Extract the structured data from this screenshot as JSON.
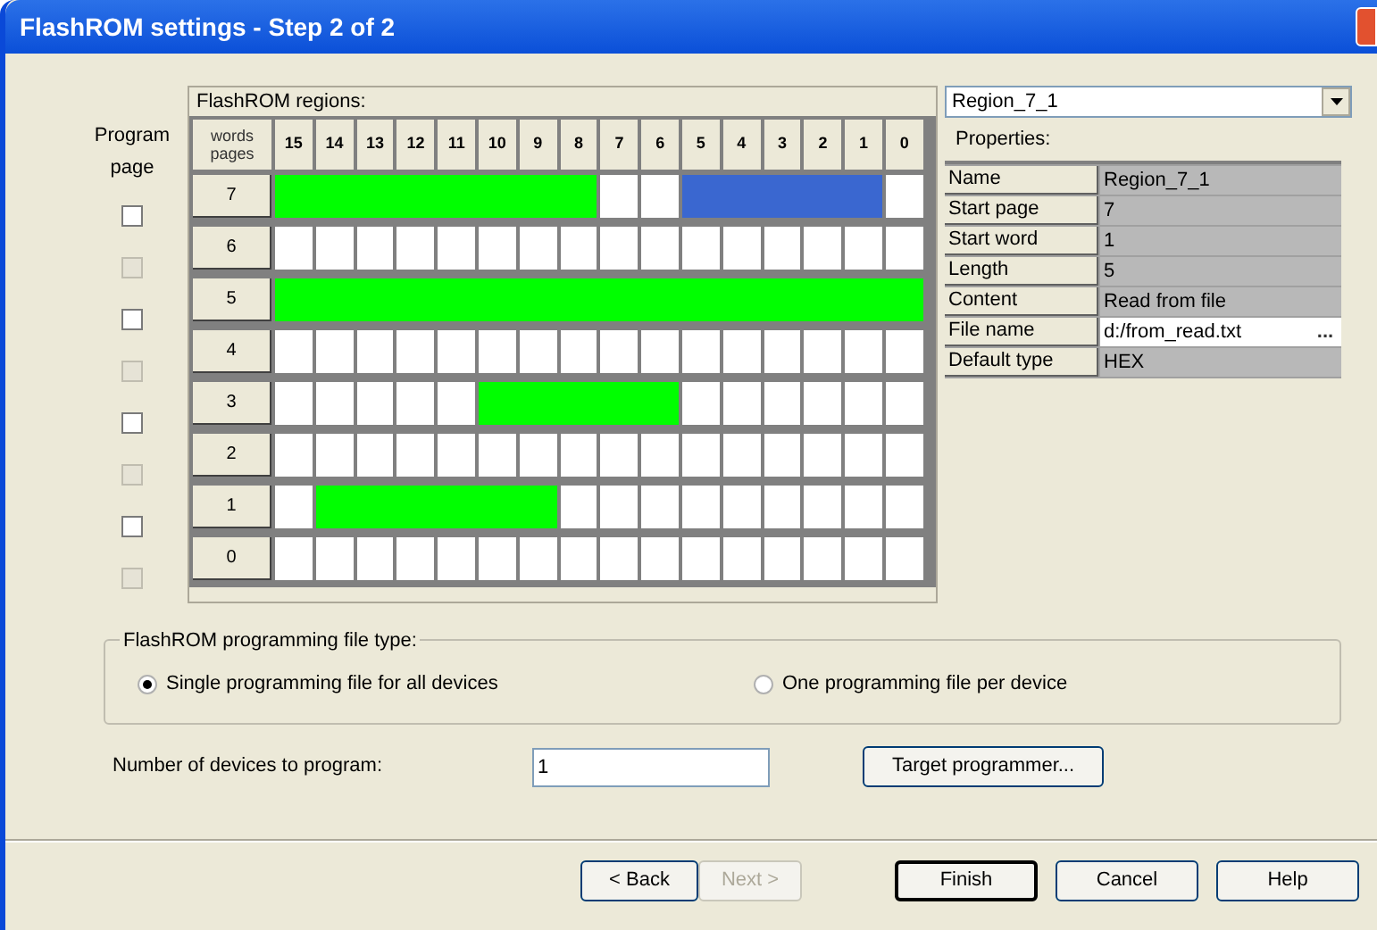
{
  "window": {
    "title": "FlashROM settings - Step 2 of 2"
  },
  "program_page_label": [
    "Program",
    "page"
  ],
  "regions_panel": {
    "title": "FlashROM regions:",
    "corner_label": [
      "words",
      "pages"
    ],
    "words": [
      "15",
      "14",
      "13",
      "12",
      "11",
      "10",
      "9",
      "8",
      "7",
      "6",
      "5",
      "4",
      "3",
      "2",
      "1",
      "0"
    ],
    "rows": [
      {
        "page": "7",
        "program": false,
        "disabled": false,
        "cells": [
          {
            "filled": true,
            "selected": false
          },
          {
            "filled": true,
            "selected": false
          },
          {
            "filled": true,
            "selected": false
          },
          {
            "filled": true,
            "selected": false
          },
          {
            "filled": true,
            "selected": false
          },
          {
            "filled": true,
            "selected": false
          },
          {
            "filled": true,
            "selected": false
          },
          {
            "filled": true,
            "selected": false
          },
          {
            "filled": false,
            "selected": false
          },
          {
            "filled": false,
            "selected": false
          },
          {
            "filled": true,
            "selected": true
          },
          {
            "filled": true,
            "selected": true
          },
          {
            "filled": true,
            "selected": true
          },
          {
            "filled": true,
            "selected": true
          },
          {
            "filled": true,
            "selected": true
          },
          {
            "filled": false,
            "selected": false
          }
        ]
      },
      {
        "page": "6",
        "program": false,
        "disabled": true,
        "cells": [
          {
            "filled": false,
            "selected": false
          },
          {
            "filled": false,
            "selected": false
          },
          {
            "filled": false,
            "selected": false
          },
          {
            "filled": false,
            "selected": false
          },
          {
            "filled": false,
            "selected": false
          },
          {
            "filled": false,
            "selected": false
          },
          {
            "filled": false,
            "selected": false
          },
          {
            "filled": false,
            "selected": false
          },
          {
            "filled": false,
            "selected": false
          },
          {
            "filled": false,
            "selected": false
          },
          {
            "filled": false,
            "selected": false
          },
          {
            "filled": false,
            "selected": false
          },
          {
            "filled": false,
            "selected": false
          },
          {
            "filled": false,
            "selected": false
          },
          {
            "filled": false,
            "selected": false
          },
          {
            "filled": false,
            "selected": false
          }
        ]
      },
      {
        "page": "5",
        "program": false,
        "disabled": false,
        "cells": [
          {
            "filled": true,
            "selected": false
          },
          {
            "filled": true,
            "selected": false
          },
          {
            "filled": true,
            "selected": false
          },
          {
            "filled": true,
            "selected": false
          },
          {
            "filled": true,
            "selected": false
          },
          {
            "filled": true,
            "selected": false
          },
          {
            "filled": true,
            "selected": false
          },
          {
            "filled": true,
            "selected": false
          },
          {
            "filled": true,
            "selected": false
          },
          {
            "filled": true,
            "selected": false
          },
          {
            "filled": true,
            "selected": false
          },
          {
            "filled": true,
            "selected": false
          },
          {
            "filled": true,
            "selected": false
          },
          {
            "filled": true,
            "selected": false
          },
          {
            "filled": true,
            "selected": false
          },
          {
            "filled": true,
            "selected": false
          }
        ]
      },
      {
        "page": "4",
        "program": false,
        "disabled": true,
        "cells": [
          {
            "filled": false,
            "selected": false
          },
          {
            "filled": false,
            "selected": false
          },
          {
            "filled": false,
            "selected": false
          },
          {
            "filled": false,
            "selected": false
          },
          {
            "filled": false,
            "selected": false
          },
          {
            "filled": false,
            "selected": false
          },
          {
            "filled": false,
            "selected": false
          },
          {
            "filled": false,
            "selected": false
          },
          {
            "filled": false,
            "selected": false
          },
          {
            "filled": false,
            "selected": false
          },
          {
            "filled": false,
            "selected": false
          },
          {
            "filled": false,
            "selected": false
          },
          {
            "filled": false,
            "selected": false
          },
          {
            "filled": false,
            "selected": false
          },
          {
            "filled": false,
            "selected": false
          },
          {
            "filled": false,
            "selected": false
          }
        ]
      },
      {
        "page": "3",
        "program": false,
        "disabled": false,
        "cells": [
          {
            "filled": false,
            "selected": false
          },
          {
            "filled": false,
            "selected": false
          },
          {
            "filled": false,
            "selected": false
          },
          {
            "filled": false,
            "selected": false
          },
          {
            "filled": false,
            "selected": false
          },
          {
            "filled": true,
            "selected": false
          },
          {
            "filled": true,
            "selected": false
          },
          {
            "filled": true,
            "selected": false
          },
          {
            "filled": true,
            "selected": false
          },
          {
            "filled": true,
            "selected": false
          },
          {
            "filled": false,
            "selected": false
          },
          {
            "filled": false,
            "selected": false
          },
          {
            "filled": false,
            "selected": false
          },
          {
            "filled": false,
            "selected": false
          },
          {
            "filled": false,
            "selected": false
          },
          {
            "filled": false,
            "selected": false
          }
        ]
      },
      {
        "page": "2",
        "program": false,
        "disabled": true,
        "cells": [
          {
            "filled": false,
            "selected": false
          },
          {
            "filled": false,
            "selected": false
          },
          {
            "filled": false,
            "selected": false
          },
          {
            "filled": false,
            "selected": false
          },
          {
            "filled": false,
            "selected": false
          },
          {
            "filled": false,
            "selected": false
          },
          {
            "filled": false,
            "selected": false
          },
          {
            "filled": false,
            "selected": false
          },
          {
            "filled": false,
            "selected": false
          },
          {
            "filled": false,
            "selected": false
          },
          {
            "filled": false,
            "selected": false
          },
          {
            "filled": false,
            "selected": false
          },
          {
            "filled": false,
            "selected": false
          },
          {
            "filled": false,
            "selected": false
          },
          {
            "filled": false,
            "selected": false
          },
          {
            "filled": false,
            "selected": false
          }
        ]
      },
      {
        "page": "1",
        "program": false,
        "disabled": false,
        "cells": [
          {
            "filled": false,
            "selected": false
          },
          {
            "filled": true,
            "selected": false
          },
          {
            "filled": true,
            "selected": false
          },
          {
            "filled": true,
            "selected": false
          },
          {
            "filled": true,
            "selected": false
          },
          {
            "filled": true,
            "selected": false
          },
          {
            "filled": true,
            "selected": false
          },
          {
            "filled": false,
            "selected": false
          },
          {
            "filled": false,
            "selected": false
          },
          {
            "filled": false,
            "selected": false
          },
          {
            "filled": false,
            "selected": false
          },
          {
            "filled": false,
            "selected": false
          },
          {
            "filled": false,
            "selected": false
          },
          {
            "filled": false,
            "selected": false
          },
          {
            "filled": false,
            "selected": false
          },
          {
            "filled": false,
            "selected": false
          }
        ]
      },
      {
        "page": "0",
        "program": false,
        "disabled": true,
        "cells": [
          {
            "filled": false,
            "selected": false
          },
          {
            "filled": false,
            "selected": false
          },
          {
            "filled": false,
            "selected": false
          },
          {
            "filled": false,
            "selected": false
          },
          {
            "filled": false,
            "selected": false
          },
          {
            "filled": false,
            "selected": false
          },
          {
            "filled": false,
            "selected": false
          },
          {
            "filled": false,
            "selected": false
          },
          {
            "filled": false,
            "selected": false
          },
          {
            "filled": false,
            "selected": false
          },
          {
            "filled": false,
            "selected": false
          },
          {
            "filled": false,
            "selected": false
          },
          {
            "filled": false,
            "selected": false
          },
          {
            "filled": false,
            "selected": false
          },
          {
            "filled": false,
            "selected": false
          },
          {
            "filled": false,
            "selected": false
          }
        ]
      }
    ]
  },
  "region_select": {
    "value": "Region_7_1"
  },
  "properties": {
    "title": "Properties:",
    "rows": [
      {
        "label": "Name",
        "value": "Region_7_1",
        "kind": "text"
      },
      {
        "label": "Start page",
        "value": "7",
        "kind": "text"
      },
      {
        "label": "Start word",
        "value": "1",
        "kind": "text"
      },
      {
        "label": "Length",
        "value": "5",
        "kind": "text"
      },
      {
        "label": "Content",
        "value": "Read from file",
        "kind": "text"
      },
      {
        "label": "File name",
        "value": "d:/from_read.txt",
        "kind": "file",
        "browse": "..."
      },
      {
        "label": "Default type",
        "value": "HEX",
        "kind": "text"
      }
    ]
  },
  "file_type": {
    "title": "FlashROM programming file type:",
    "options": [
      {
        "label": "Single programming file for all devices",
        "selected": true
      },
      {
        "label": "One programming file per device",
        "selected": false
      }
    ]
  },
  "devices": {
    "label": "Number of devices to program:",
    "value": "1",
    "button": "Target programmer..."
  },
  "buttons": [
    {
      "label": "< Back",
      "disabled": false,
      "default": false
    },
    {
      "label": "Next >",
      "disabled": true,
      "default": false
    },
    {
      "label": "Finish",
      "disabled": false,
      "default": true
    },
    {
      "label": "Cancel",
      "disabled": false,
      "default": false
    },
    {
      "label": "Help",
      "disabled": false,
      "default": false
    }
  ]
}
